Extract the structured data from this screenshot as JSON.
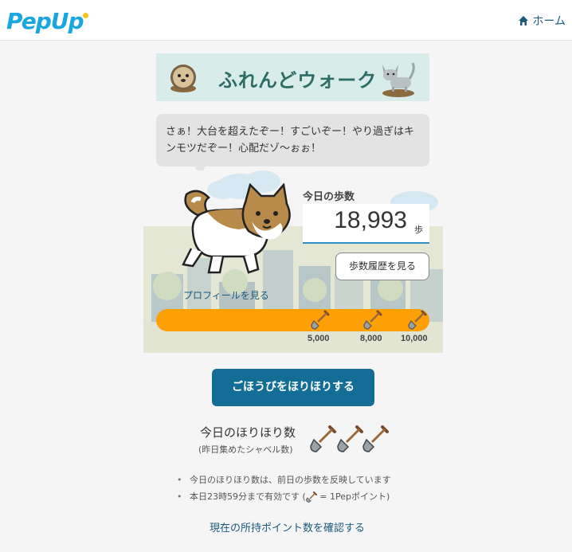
{
  "header": {
    "logo_text": "PepUp",
    "home_label": "ホーム"
  },
  "banner": {
    "title": "ふれんどウォーク"
  },
  "bubble": {
    "message": "さぁ！大台を超えたぞー！すごいぞー！やり過ぎはキンモツだぞー！心配だゾ〜ぉぉ！"
  },
  "steps": {
    "label": "今日の歩数",
    "value": "18,993",
    "unit": "歩",
    "history_button": "歩数履歴を見る"
  },
  "profile_link": "プロフィールを見る",
  "progress": {
    "milestones": [
      "5,000",
      "8,000",
      "10,000"
    ],
    "milestone_values": [
      5000,
      8000,
      10000
    ],
    "current_steps": 18993
  },
  "reward_button": "ごほうびをほりほりする",
  "dig": {
    "title": "今日のほりほり数",
    "subtitle": "(昨日集めたシャベル数)",
    "shovel_count": 3
  },
  "notes": {
    "line1": "今日のほりほり数は、前日の歩数を反映しています",
    "line2_prefix": "本日23時59分まで有効です (",
    "line2_suffix": " = 1Pepポイント)"
  },
  "points_link": "現在の所持ポイント数を確認する",
  "colors": {
    "brand": "#1aa6e0",
    "accent_orange": "#fda006",
    "button_blue": "#136d96",
    "link": "#1c5a7c"
  }
}
